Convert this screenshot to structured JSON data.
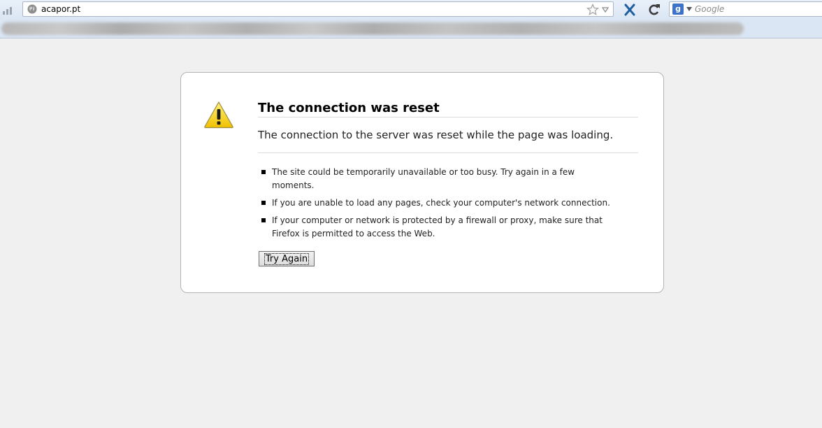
{
  "toolbar": {
    "url": "acapor.pt",
    "search_placeholder": "Google",
    "engine_icon": "google-icon"
  },
  "error": {
    "title": "The connection was reset",
    "description": "The connection to the server was reset while the page was loading.",
    "items": [
      "The site could be temporarily unavailable or too busy. Try again in a few moments.",
      "If you are unable to load any pages, check your computer's network connection.",
      "If your computer or network is protected by a firewall or proxy, make sure that Firefox is permitted to access the Web."
    ],
    "button_label": "Try Again"
  },
  "colors": {
    "toolbar_bg": "#dbe6f4",
    "page_bg": "#f0f0f0",
    "warning_yellow": "#f5d21c",
    "stop_blue": "#1f5fa0"
  }
}
